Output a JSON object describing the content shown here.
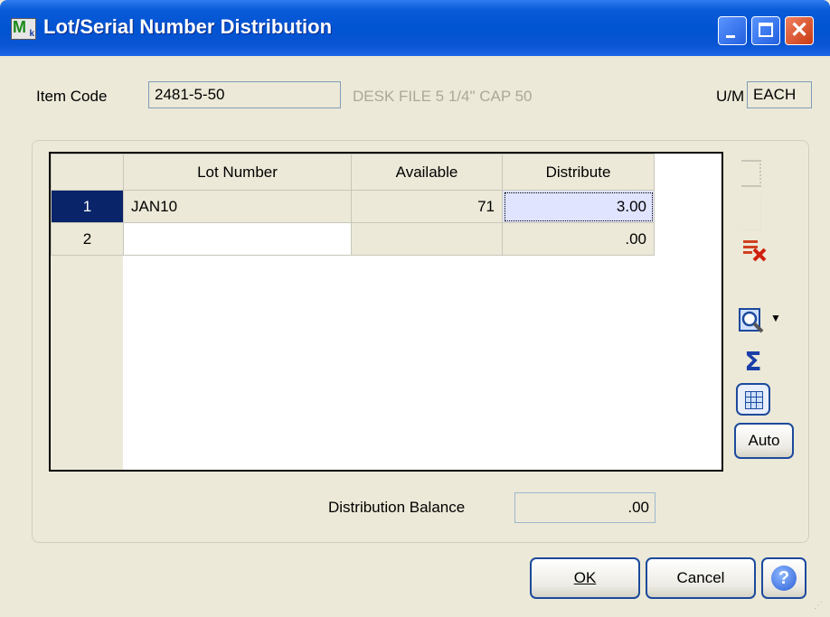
{
  "window": {
    "title": "Lot/Serial Number Distribution"
  },
  "item": {
    "code_label": "Item Code",
    "code_value": "2481-5-50",
    "description": "DESK FILE 5 1/4\" CAP 50",
    "um_label": "U/M",
    "um_value": "EACH"
  },
  "grid": {
    "columns": [
      "Lot Number",
      "Available",
      "Distribute"
    ],
    "rows": [
      {
        "num": "1",
        "lot": "JAN10",
        "available": "71",
        "distribute": "3.00"
      },
      {
        "num": "2",
        "lot": "",
        "available": "",
        "distribute": ".00"
      }
    ]
  },
  "distribution_balance": {
    "label": "Distribution Balance",
    "value": ".00"
  },
  "buttons": {
    "auto": "Auto",
    "ok": "OK",
    "cancel": "Cancel",
    "help": "?"
  },
  "toolbar_icons": [
    "insert-row-icon",
    "blank-icon",
    "delete-row-icon",
    "lookup-zoom-icon",
    "dropdown-arrow-icon",
    "sum-icon",
    "grid-layout-icon"
  ]
}
